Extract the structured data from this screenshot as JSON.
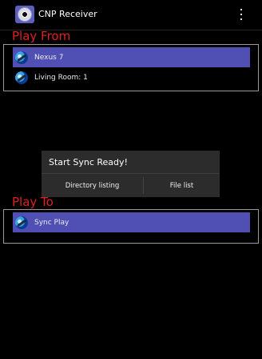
{
  "app": {
    "title": "CNP Receiver",
    "icon": "cnp-receiver-app-icon",
    "overflow_icon": "more-vert-icon"
  },
  "play_from": {
    "label": "Play From",
    "items": [
      {
        "label": "Nexus 7",
        "icon": "device-globe-icon",
        "selected": true
      },
      {
        "label": "Living Room: 1",
        "icon": "device-globe-icon",
        "selected": false
      }
    ]
  },
  "dialog": {
    "title": "Start Sync Ready!",
    "buttons": [
      {
        "label": "Directory listing"
      },
      {
        "label": "File list"
      }
    ]
  },
  "play_to": {
    "label": "Play To",
    "items": [
      {
        "label": "Sync Play",
        "icon": "device-globe-icon",
        "selected": true
      }
    ]
  },
  "colors": {
    "background": "#000000",
    "section_label": "#e0201c",
    "selected_row": "#5050b4",
    "dialog_bg": "#2c2c2c"
  }
}
